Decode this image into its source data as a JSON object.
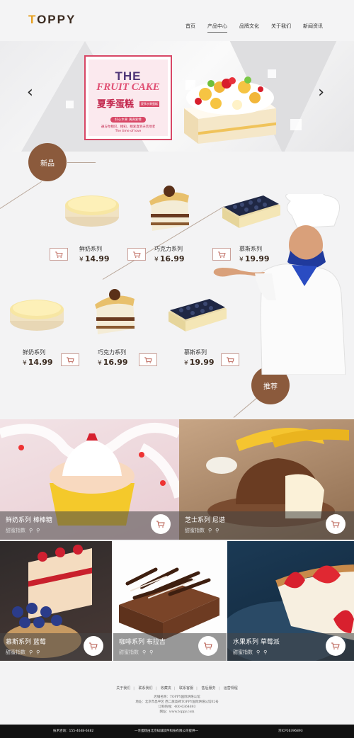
{
  "header": {
    "logo": "TOPPY",
    "nav": [
      "首页",
      "产品中心",
      "品牌文化",
      "关于我们",
      "新闻资讯"
    ],
    "active_nav": "产品中心"
  },
  "banner": {
    "title_line1": "THE",
    "title_line2": "FRUIT CAKE",
    "cn_title": "夏季蛋糕",
    "tag": "夏季水果蛋糕",
    "pill": "好心水果 满满爱情",
    "line2": "通与你相识，相知，相爱直到天荒地老",
    "line3": "The time of love",
    "prev": "‹",
    "next": "›"
  },
  "products": {
    "new_badge": "新品",
    "recommend_badge": "推荐",
    "items": [
      {
        "name": "鲜奶系列",
        "price": "14.99",
        "currency": "¥"
      },
      {
        "name": "巧克力系列",
        "price": "16.99",
        "currency": "¥"
      },
      {
        "name": "慕斯系列",
        "price": "19.99",
        "currency": "¥"
      },
      {
        "name": "鲜奶系列",
        "price": "14.99",
        "currency": "¥"
      },
      {
        "name": "巧克力系列",
        "price": "16.99",
        "currency": "¥"
      },
      {
        "name": "慕斯系列",
        "price": "19.99",
        "currency": "¥"
      }
    ]
  },
  "recommend": [
    {
      "title": "鲜奶系列  棒棒糖",
      "sub": "甜蜜指数"
    },
    {
      "title": "芝士系列  尼谱",
      "sub": "甜蜜指数"
    },
    {
      "title": "慕斯系列  蓝莓",
      "sub": "甜蜜指数"
    },
    {
      "title": "咖啡系列  布拉吉",
      "sub": "甜蜜指数"
    },
    {
      "title": "水果系列  草莓派",
      "sub": "甜蜜指数"
    }
  ],
  "footer": {
    "links": [
      "关于我们",
      "联系我们",
      "收藏夹",
      "联系客服",
      "售后服务",
      "运营规程"
    ],
    "info": [
      "店铺名称：TOPPY国际烘焙公馆",
      "地址：北京市昌平区 西二旗高碑TOPPY国际烘焙公馆02号",
      "订购热线：400-6364893",
      "网址：www.toppy.com"
    ],
    "bar_left": "技术咨询：155-4648-6482",
    "bar_center": "一亲蛋糕由北京知诚软件科技有限公司提供一",
    "bar_right": "京ICP16396893"
  },
  "colors": {
    "accent": "#8b5a3c",
    "promo_pink": "#d84766",
    "logo_orange": "#e6a021"
  }
}
